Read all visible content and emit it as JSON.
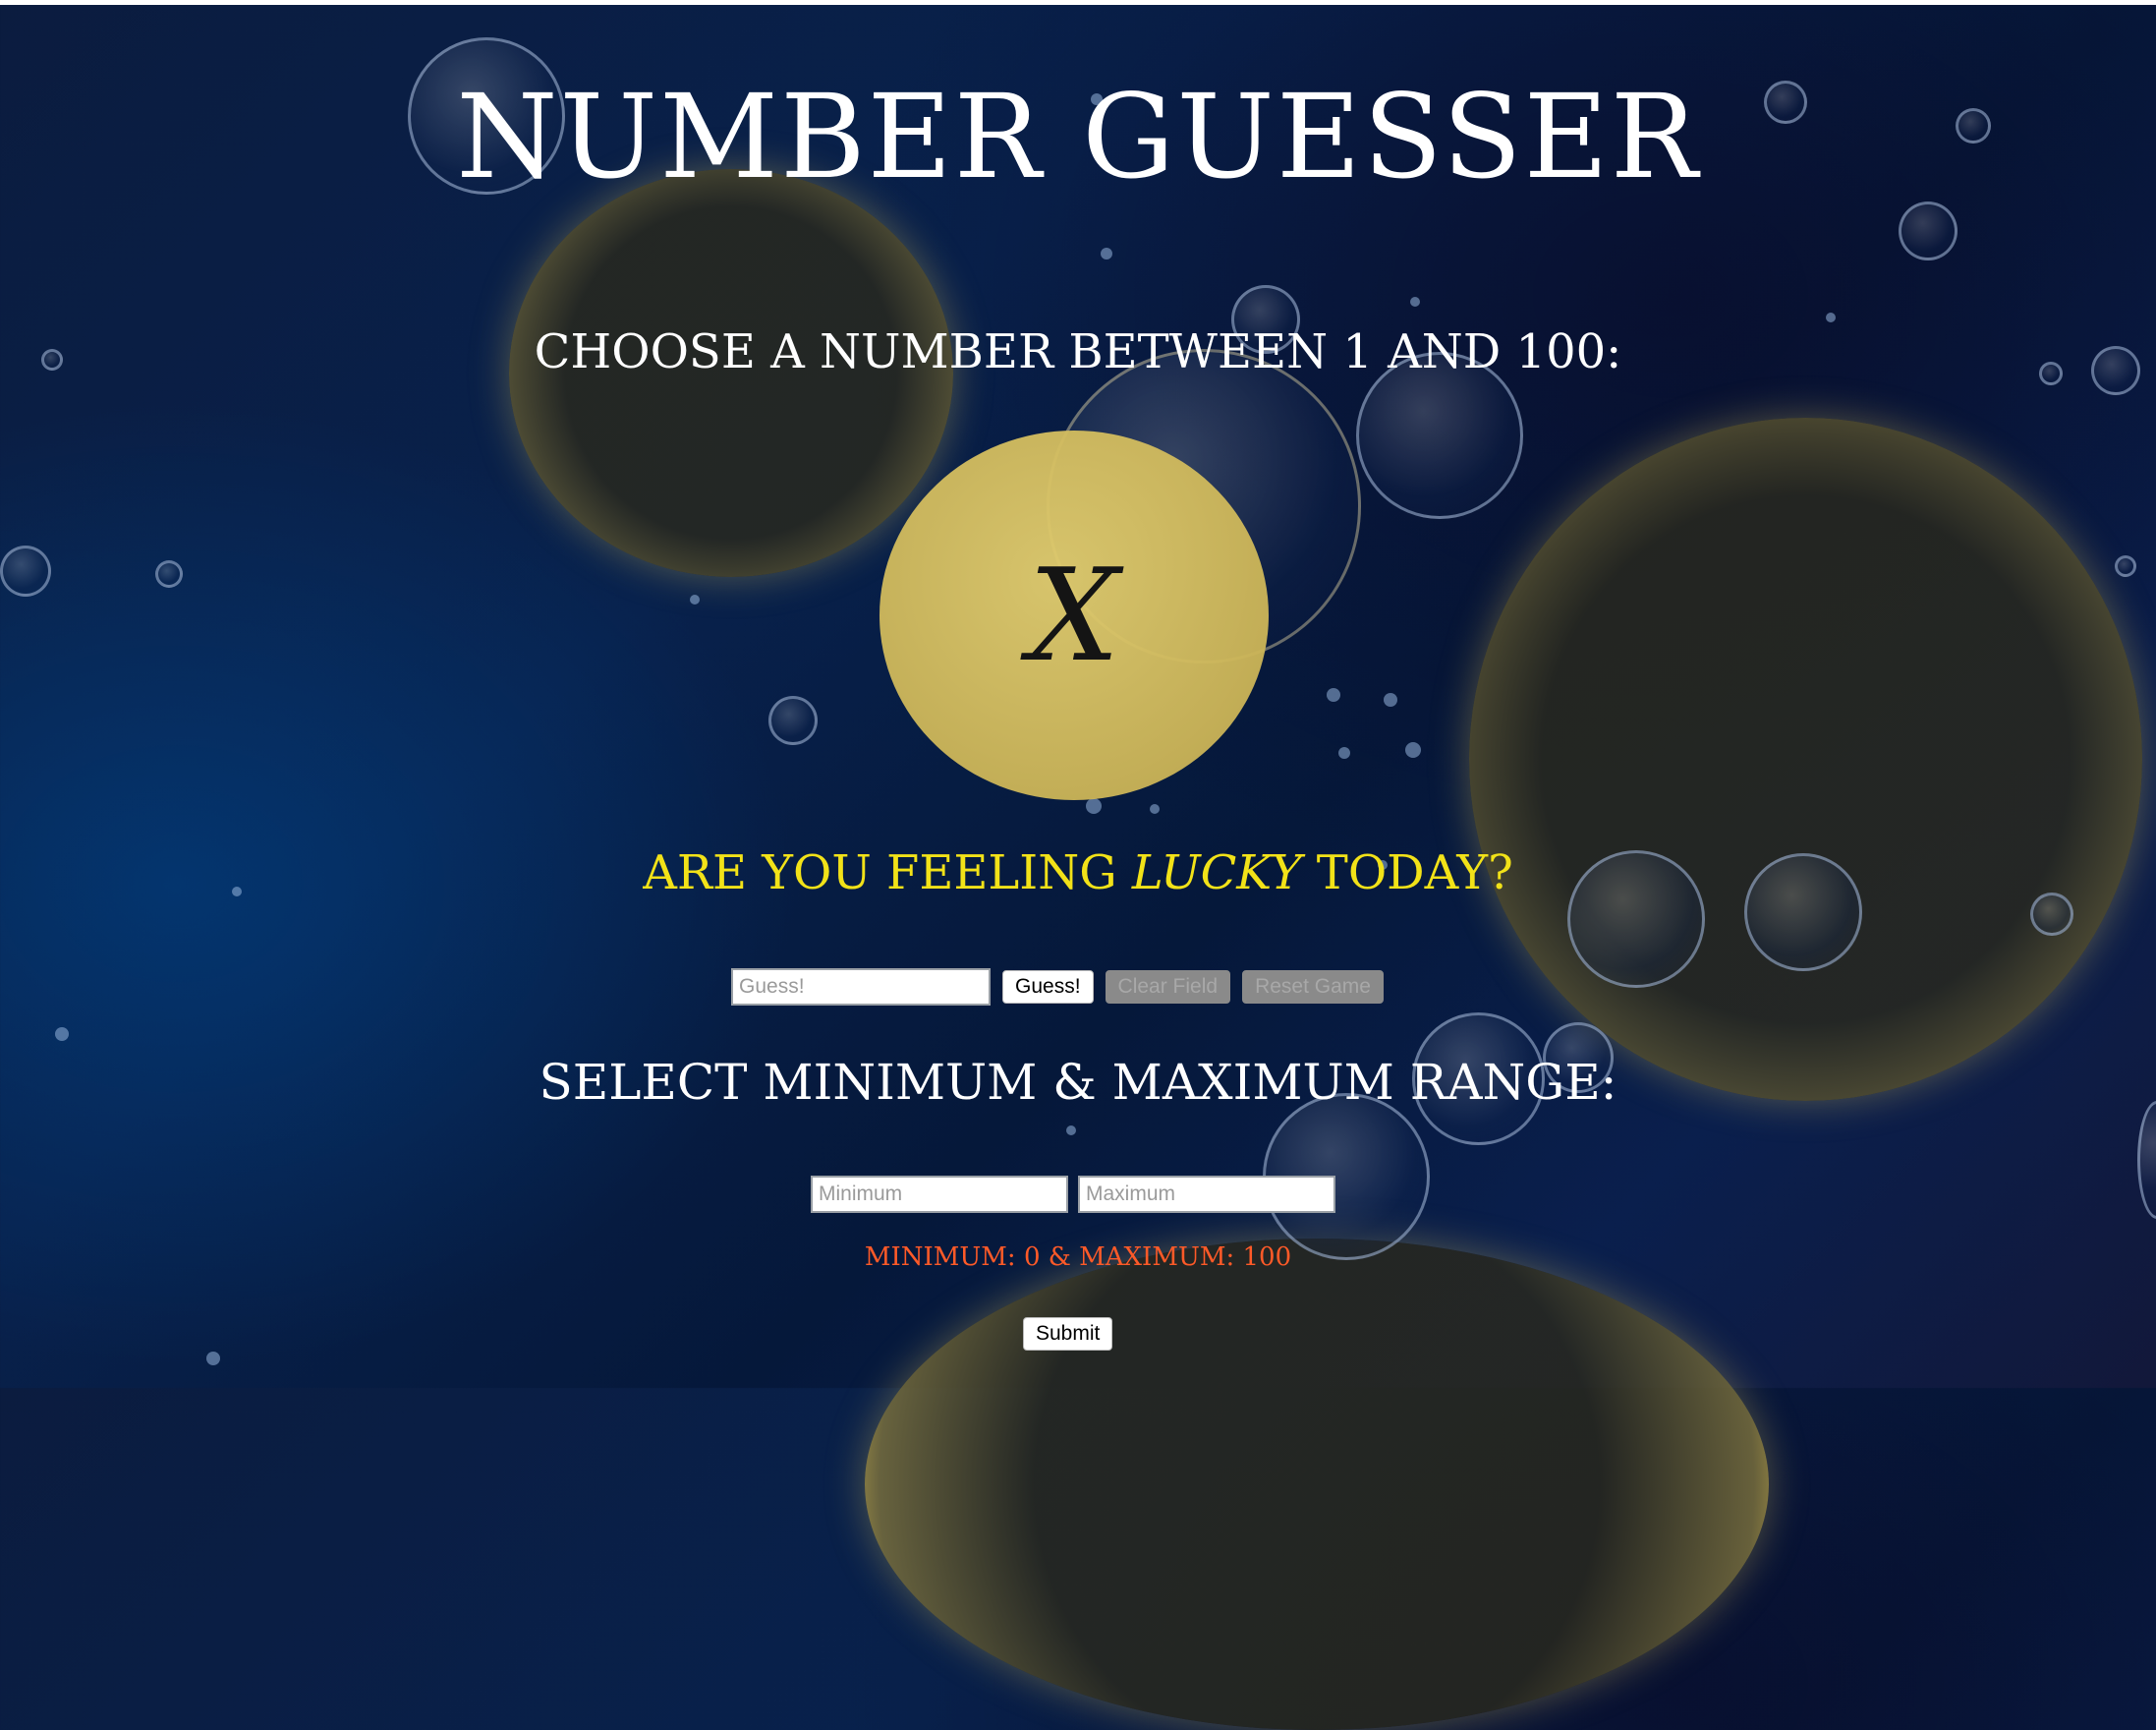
{
  "page": {
    "title": "NUMBER GUESSER",
    "prompt": "CHOOSE A NUMBER BETWEEN 1 AND 100:",
    "guess_display": "X",
    "lucky_prefix": "ARE YOU FEELING ",
    "lucky_emphasis": "LUCKY",
    "lucky_suffix": " TODAY?"
  },
  "guess_controls": {
    "guess_placeholder": "Guess!",
    "guess_button": "Guess!",
    "clear_button": "Clear Field",
    "reset_button": "Reset Game"
  },
  "range_controls": {
    "title": "SELECT MINIMUM & MAXIMUM RANGE:",
    "min_placeholder": "Minimum",
    "max_placeholder": "Maximum",
    "note": "MINIMUM: 0 & MAXIMUM: 100",
    "submit_button": "Submit"
  },
  "colors": {
    "accent_yellow": "#f2e218",
    "note_orange": "#ff5a28",
    "circle_gold": "#d9c56a"
  }
}
